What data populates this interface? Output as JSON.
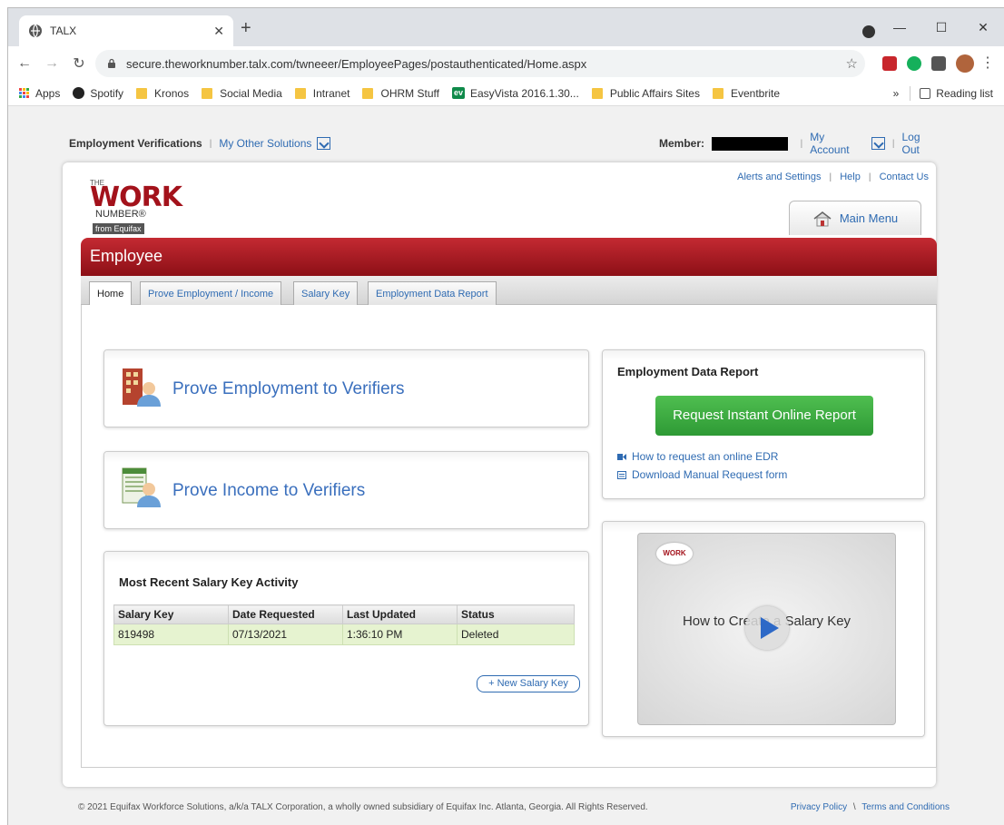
{
  "browser": {
    "tab_title": "TALX",
    "url": "secure.theworknumber.talx.com/twneeer/EmployeePages/postauthenticated/Home.aspx",
    "bookmarks": [
      "Apps",
      "Spotify",
      "Kronos",
      "Social Media",
      "Intranet",
      "OHRM Stuff",
      "EasyVista 2016.1.30...",
      "Public Affairs Sites",
      "Eventbrite"
    ],
    "overflow": "»",
    "reading_list": "Reading list"
  },
  "topbar": {
    "section": "Employment Verifications",
    "other_solutions": "My Other Solutions",
    "member_label": "Member:",
    "my_account": "My Account",
    "logout": "Log Out"
  },
  "utils": {
    "alerts": "Alerts and Settings",
    "help": "Help",
    "contact": "Contact Us"
  },
  "logo": {
    "the": "THE",
    "work": "WORK",
    "number": "NUMBER®",
    "from": "from Equifax"
  },
  "main_menu": "Main Menu",
  "header_title": "Employee",
  "tabs": [
    "Home",
    "Prove Employment / Income",
    "Salary Key",
    "Employment Data Report"
  ],
  "prove_employment": "Prove Employment to Verifiers",
  "prove_income": "Prove Income to Verifiers",
  "salary_key_activity": {
    "title": "Most Recent Salary Key Activity",
    "columns": [
      "Salary Key",
      "Date Requested",
      "Last Updated",
      "Status"
    ],
    "rows": [
      [
        "819498",
        "07/13/2021",
        "1:36:10 PM",
        "Deleted"
      ]
    ],
    "new_button": "+ New Salary Key"
  },
  "edr": {
    "title": "Employment Data Report",
    "button": "Request Instant Online Report",
    "link1": "How to request an online EDR",
    "link2": "Download Manual Request form"
  },
  "video": {
    "logo": "WORK",
    "title": "How to Create a Salary Key"
  },
  "footer": {
    "copyright": "© 2021 Equifax Workforce Solutions, a/k/a TALX Corporation, a wholly owned subsidiary of Equifax Inc. Atlanta, Georgia. All Rights Reserved.",
    "privacy": "Privacy Policy",
    "separator": "\\",
    "terms": "Terms and Conditions"
  },
  "colors": {
    "brand_red": "#a3121b",
    "link_blue": "#2f6bb2",
    "cta_green": "#3aa83f"
  }
}
